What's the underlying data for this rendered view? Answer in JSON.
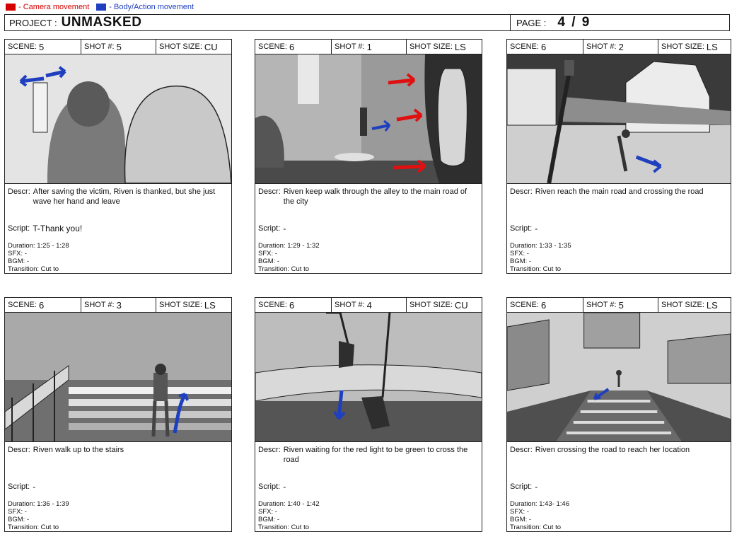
{
  "legend": {
    "camera": {
      "label": "- Camera movement",
      "color": "#d40000"
    },
    "body": {
      "label": "- Body/Action movement",
      "color": "#1f3fbf"
    }
  },
  "header": {
    "project_label": "PROJECT :",
    "project_name": "UNMASKED",
    "page_label": "PAGE :",
    "page_value": "4 / 9"
  },
  "labels": {
    "scene": "SCENE:",
    "shot": "SHOT #:",
    "shot_size": "SHOT SIZE:",
    "descr": "Descr:",
    "script": "Script:",
    "duration": "Duration:",
    "sfx": "SFX:",
    "bgm": "BGM:",
    "transition": "Transition:"
  },
  "panels": [
    {
      "scene": "5",
      "shot": "5",
      "size": "CU",
      "descr": "After saving the victim, Riven is thanked, but she just wave her hand and leave",
      "script": "T-Thank you!",
      "duration": "1:25 - 1:28",
      "sfx": "-",
      "bgm": "-",
      "transition": "Cut to"
    },
    {
      "scene": "6",
      "shot": "1",
      "size": "LS",
      "descr": "Riven keep walk through the alley to the main road of the city",
      "script": "-",
      "duration": "1:29 - 1:32",
      "sfx": "-",
      "bgm": "-",
      "transition": "Cut to"
    },
    {
      "scene": "6",
      "shot": "2",
      "size": "LS",
      "descr": "Riven reach the main road and crossing the road",
      "script": "-",
      "duration": "1:33 - 1:35",
      "sfx": "-",
      "bgm": "-",
      "transition": "Cut to"
    },
    {
      "scene": "6",
      "shot": "3",
      "size": "LS",
      "descr": "Riven walk up to the stairs",
      "script": "-",
      "duration": "1:36 - 1:39",
      "sfx": "-",
      "bgm": "-",
      "transition": "Cut to"
    },
    {
      "scene": "6",
      "shot": "4",
      "size": "CU",
      "descr": "Riven waiting for the red light to be green to cross the road",
      "script": "-",
      "duration": "1:40 - 1:42",
      "sfx": "-",
      "bgm": "-",
      "transition": "Cut to"
    },
    {
      "scene": "6",
      "shot": "5",
      "size": "LS",
      "descr": "Riven crossing the road to reach her location",
      "script": "-",
      "duration": "1:43- 1:46",
      "sfx": "-",
      "bgm": "-",
      "transition": "Cut to"
    }
  ]
}
